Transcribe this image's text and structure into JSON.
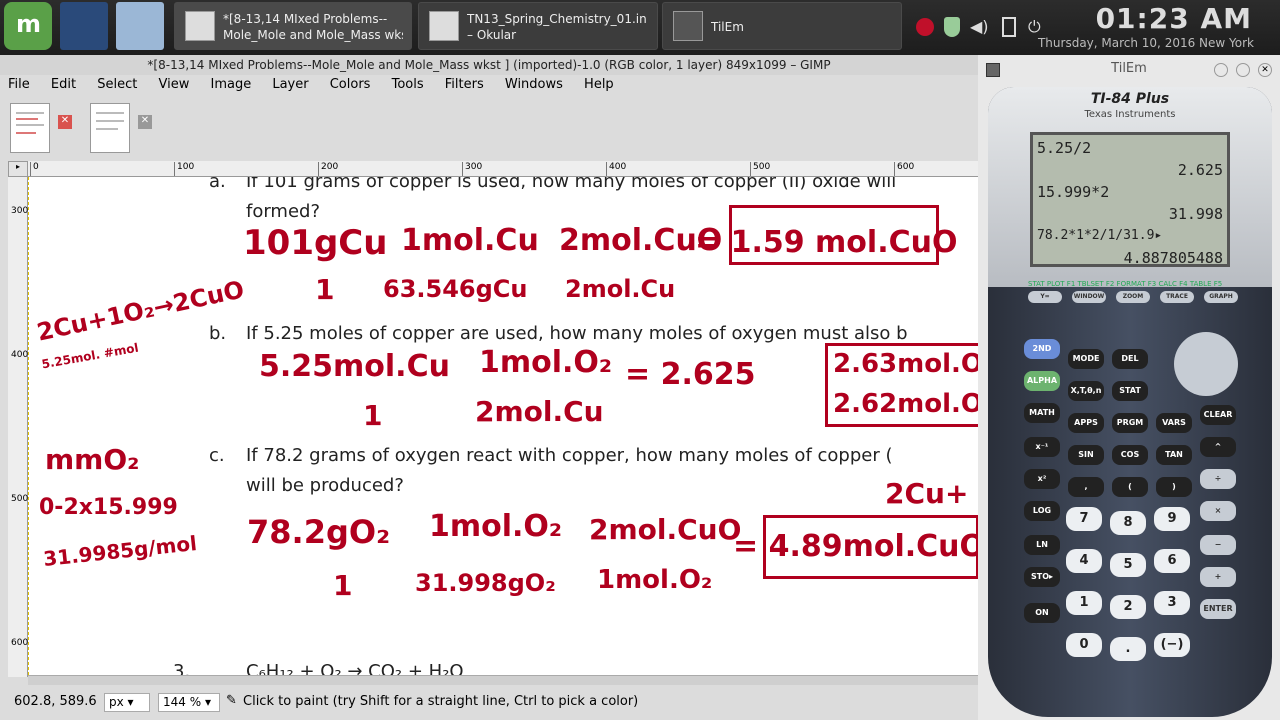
{
  "taskbar": {
    "tasks": [
      {
        "label": "*[8-13,14 MIxed Problems--\nMole_Mole and Mole_Mass wkst"
      },
      {
        "label": "TN13_Spring_Chemistry_01.indd\n– Okular"
      },
      {
        "label": "TilEm"
      }
    ],
    "time": "01:23 AM",
    "date": "Thursday, March 10, 2016 New York"
  },
  "gimp": {
    "title": "*[8-13,14 MIxed Problems--Mole_Mole and Mole_Mass wkst ] (imported)-1.0 (RGB color, 1 layer) 849x1099 – GIMP",
    "menu": [
      "File",
      "Edit",
      "Select",
      "View",
      "Image",
      "Layer",
      "Colors",
      "Tools",
      "Filters",
      "Windows",
      "Help"
    ],
    "ruler_h": [
      "0",
      "100",
      "200",
      "300",
      "400",
      "500",
      "600"
    ],
    "ruler_v": [
      "300",
      "400",
      "500",
      "600"
    ],
    "doc": {
      "a_label": "a.",
      "a_text1": "If 101 grams of copper is used, how many moles of copper (II) oxide will",
      "a_text2": "formed?",
      "b_label": "b.",
      "b_text": "If 5.25 moles of copper are used, how many moles of oxygen must also b",
      "c_label": "c.",
      "c_text1": "If 78.2 grams of oxygen react with copper, how many moles of copper (",
      "c_text2": "will be produced?",
      "next_num": "3.",
      "next_text": "C₆H₁₂ + O₂ → CO₂ + H₂O"
    },
    "ink": {
      "a_n1": "101gCu",
      "a_d1": "1",
      "a_n2": "1mol.Cu",
      "a_d2": "63.546gCu",
      "a_n3": "2mol.CuO",
      "a_d3": "2mol.Cu",
      "a_ans": "= 1.59 mol.CuO",
      "side_eq": "2Cu+1O₂→2CuO",
      "side_sub": "5.25mol. #mol",
      "b_n1": "5.25mol.Cu",
      "b_d1": "1",
      "b_n2": "1mol.O₂",
      "b_d2": "2mol.Cu",
      "b_ans": "= 2.625",
      "b_box1": "2.63mol.O",
      "b_box2": "2.62mol.O",
      "side_mm": "mmO₂",
      "side_calc": "0-2x15.999",
      "side_res": "31.9985g/mol",
      "c_n1": "78.2gO₂",
      "c_d1": "1",
      "c_n2": "1mol.O₂",
      "c_d2": "31.998gO₂",
      "c_n3": "2mol.CuO",
      "c_d3": "1mol.O₂",
      "c_ans": "= 4.89mol.CuO",
      "c_side": "2Cu+"
    },
    "status": {
      "coords": "602.8, 589.6",
      "unit": "px",
      "zoom": "144 %",
      "message": "Click to paint (try Shift for a straight line, Ctrl to pick a color)"
    }
  },
  "tilem": {
    "title": "TilEm",
    "model": "TI-84 Plus",
    "maker": "Texas Instruments",
    "screen": [
      "5.25/2",
      "2.625",
      "15.999*2",
      "31.998",
      "78.2*1*2/1/31.9▸",
      "4.887805488"
    ],
    "top_keys": [
      "STAT PLOT F1  TBLSET F2  FORMAT F3  CALC F4  TABLE F5"
    ],
    "fkeys": [
      "Y=",
      "WINDOW",
      "ZOOM",
      "TRACE",
      "GRAPH"
    ],
    "keys": [
      "2ND",
      "MODE",
      "DEL",
      "ALPHA",
      "X,T,θ,n",
      "STAT",
      "MATH",
      "APPS",
      "PRGM",
      "VARS",
      "CLEAR",
      "x⁻¹",
      "SIN",
      "COS",
      "TAN",
      "^",
      "x²",
      ",",
      "(",
      ")",
      "÷",
      "LOG",
      "7",
      "8",
      "9",
      "×",
      "LN",
      "4",
      "5",
      "6",
      "−",
      "STO▸",
      "1",
      "2",
      "3",
      "+",
      "ON",
      "0",
      ".",
      "(−)",
      "ENTER"
    ]
  }
}
